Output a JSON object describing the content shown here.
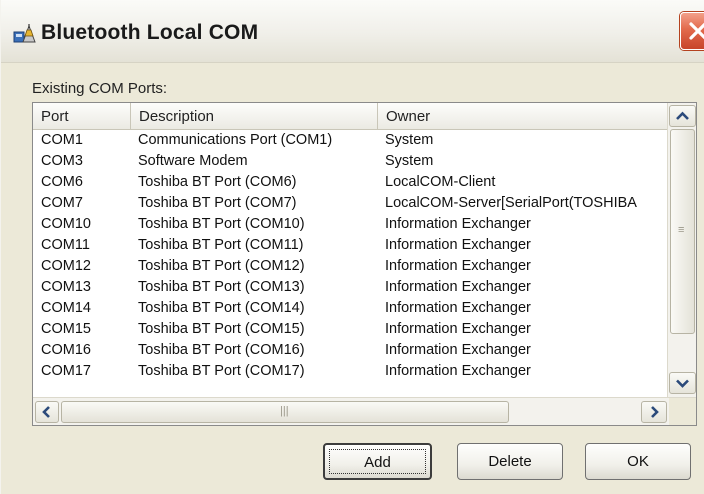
{
  "window": {
    "title": "Bluetooth Local COM",
    "app_icon": "bluetooth-com-port-icon",
    "close_icon": "close-icon",
    "accent_close": "#d95a3c"
  },
  "ports_group": {
    "label": "Existing COM Ports:"
  },
  "table": {
    "columns": [
      "Port",
      "Description",
      "Owner"
    ],
    "rows": [
      {
        "port": "COM1",
        "description": "Communications Port (COM1)",
        "owner": "System"
      },
      {
        "port": "COM3",
        "description": "Software Modem",
        "owner": "System"
      },
      {
        "port": "COM6",
        "description": "Toshiba BT Port (COM6)",
        "owner": "LocalCOM-Client"
      },
      {
        "port": "COM7",
        "description": "Toshiba BT Port (COM7)",
        "owner": "LocalCOM-Server[SerialPort(TOSHIBA"
      },
      {
        "port": "COM10",
        "description": "Toshiba BT Port (COM10)",
        "owner": "Information Exchanger"
      },
      {
        "port": "COM11",
        "description": "Toshiba BT Port (COM11)",
        "owner": "Information Exchanger"
      },
      {
        "port": "COM12",
        "description": "Toshiba BT Port (COM12)",
        "owner": "Information Exchanger"
      },
      {
        "port": "COM13",
        "description": "Toshiba BT Port (COM13)",
        "owner": "Information Exchanger"
      },
      {
        "port": "COM14",
        "description": "Toshiba BT Port (COM14)",
        "owner": "Information Exchanger"
      },
      {
        "port": "COM15",
        "description": "Toshiba BT Port (COM15)",
        "owner": "Information Exchanger"
      },
      {
        "port": "COM16",
        "description": "Toshiba BT Port (COM16)",
        "owner": "Information Exchanger"
      },
      {
        "port": "COM17",
        "description": "Toshiba BT Port (COM17)",
        "owner": "Information Exchanger"
      }
    ]
  },
  "scrollbars": {
    "up_icon": "chevron-up-icon",
    "down_icon": "chevron-down-icon",
    "left_icon": "chevron-left-icon",
    "right_icon": "chevron-right-icon"
  },
  "buttons": {
    "add": "Add",
    "delete": "Delete",
    "ok": "OK"
  }
}
